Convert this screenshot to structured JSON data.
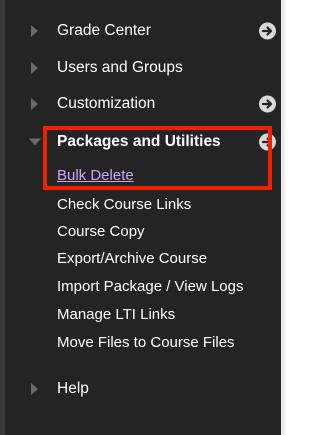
{
  "menu": {
    "sections": [
      {
        "label": "Grade Center",
        "expanded": false,
        "go_icon": true
      },
      {
        "label": "Users and Groups",
        "expanded": false,
        "go_icon": false
      },
      {
        "label": "Customization",
        "expanded": false,
        "go_icon": true
      },
      {
        "label": "Packages and Utilities",
        "expanded": true,
        "go_icon": true
      },
      {
        "label": "Help",
        "expanded": false,
        "go_icon": false
      }
    ],
    "packages_items": [
      {
        "label": "Bulk Delete"
      },
      {
        "label": "Check Course Links"
      },
      {
        "label": "Course Copy"
      },
      {
        "label": "Export/Archive Course"
      },
      {
        "label": "Import Package / View Logs"
      },
      {
        "label": "Manage LTI Links"
      },
      {
        "label": "Move Files to Course Files"
      }
    ]
  },
  "colors": {
    "panel_bg": "#242424",
    "highlight_border": "#ee2200",
    "link_color": "#c9a7ee"
  },
  "icons": {
    "collapsed": "chevron-right-icon",
    "expanded": "chevron-down-icon",
    "go": "arrow-circle-right-icon"
  }
}
